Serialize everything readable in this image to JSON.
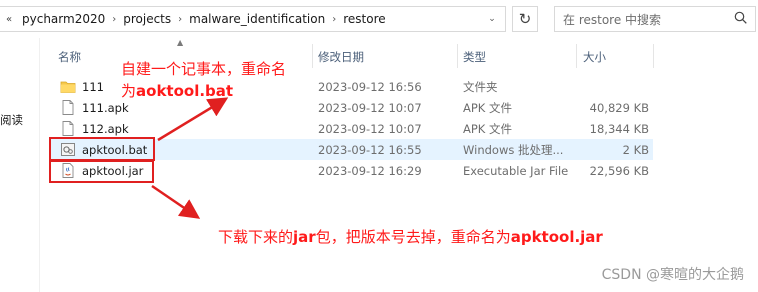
{
  "address": {
    "overflow_label": "«",
    "crumbs": [
      "pycharm2020",
      "projects",
      "malware_identification",
      "restore"
    ],
    "separator": "›",
    "dropdown": "⌄",
    "refresh": "↻"
  },
  "search": {
    "placeholder": "在 restore 中搜索"
  },
  "nav": {
    "label": "阅读"
  },
  "headers": {
    "name": "名称",
    "date": "修改日期",
    "type": "类型",
    "size": "大小"
  },
  "files": [
    {
      "name": "111",
      "date": "2023-09-12 16:56",
      "type": "文件夹",
      "size": "",
      "icon": "folder-icon"
    },
    {
      "name": "111.apk",
      "date": "2023-09-12 10:07",
      "type": "APK 文件",
      "size": "40,829 KB",
      "icon": "file-icon"
    },
    {
      "name": "112.apk",
      "date": "2023-09-12 10:07",
      "type": "APK 文件",
      "size": "18,344 KB",
      "icon": "file-icon"
    },
    {
      "name": "apktool.bat",
      "date": "2023-09-12 16:55",
      "type": "Windows 批处理...",
      "size": "2 KB",
      "icon": "batch-file-icon"
    },
    {
      "name": "apktool.jar",
      "date": "2023-09-12 16:29",
      "type": "Executable Jar File",
      "size": "22,596 KB",
      "icon": "jar-file-icon"
    }
  ],
  "annotations": {
    "top_line1": "自建一个记事本，重命名",
    "top_line2_prefix": "为",
    "top_line2_bold": "aoktool.bat",
    "bottom_prefix": "下载下来的",
    "bottom_bold1": "jar",
    "bottom_mid": "包，把版本号去掉，重命名为",
    "bottom_bold2": "apktool.jar"
  },
  "watermark": "CSDN @寒暄的大企鹅",
  "colors": {
    "annotation": "#ff1a1a",
    "highlight_row": "#e5f3ff",
    "header_text": "#4c607a",
    "folder": "#f5c84c"
  }
}
